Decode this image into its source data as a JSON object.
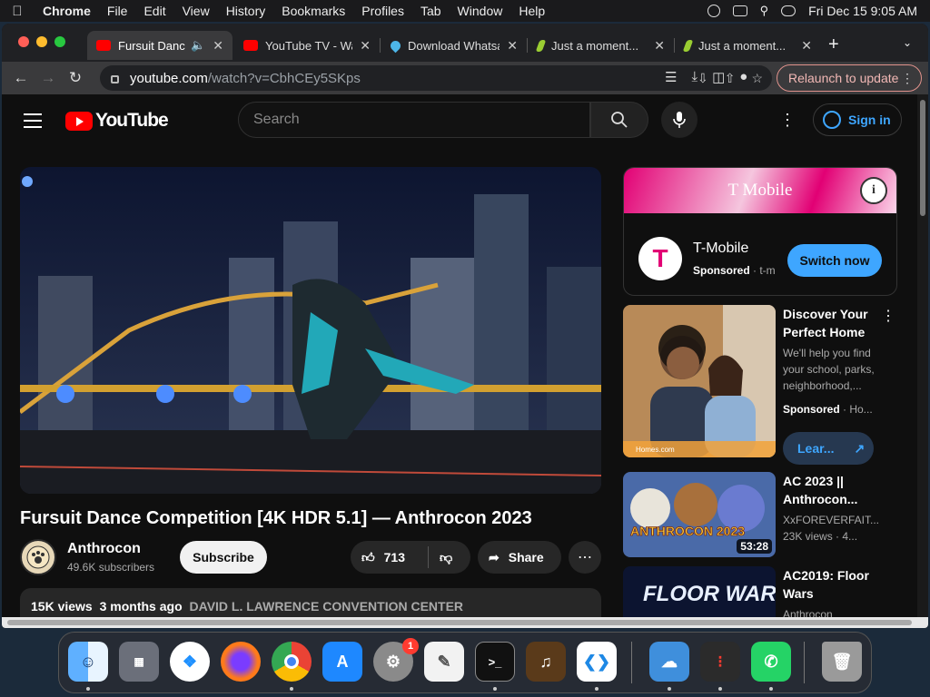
{
  "menubar": {
    "app": "Chrome",
    "items": [
      "File",
      "Edit",
      "View",
      "History",
      "Bookmarks",
      "Profiles",
      "Tab",
      "Window",
      "Help"
    ],
    "clock": "Fri Dec 15  9:05 AM"
  },
  "tabs": [
    {
      "title": "Fursuit Dance",
      "favicon": "youtube-icon",
      "color": "#ff0000",
      "active": true
    },
    {
      "title": "YouTube TV - Wa",
      "favicon": "youtube-icon",
      "color": "#ff0000",
      "active": false
    },
    {
      "title": "Download Whatsa",
      "favicon": "download-icon",
      "color": "#4db6e8",
      "active": false
    },
    {
      "title": "Just a moment...",
      "favicon": "leaf-icon",
      "color": "#9acd32",
      "active": false
    },
    {
      "title": "Just a moment...",
      "favicon": "leaf-icon",
      "color": "#9acd32",
      "active": false
    }
  ],
  "toolbar": {
    "url_host": "youtube.com",
    "url_path": "/watch?v=CbhCEy5SKps",
    "relaunch_label": "Relaunch to update"
  },
  "yt": {
    "logo_text": "YouTube",
    "search_placeholder": "Search",
    "signin_label": "Sign in"
  },
  "video": {
    "title": "Fursuit Dance Competition [4K HDR 5.1] — Anthrocon 2023",
    "channel": "Anthrocon",
    "subscribers": "49.6K subscribers",
    "subscribe_label": "Subscribe",
    "likes": "713",
    "share_label": "Share",
    "views": "15K views",
    "age": "3 months ago",
    "location": "DAVID L. LAWRENCE CONVENTION CENTER"
  },
  "ad": {
    "banner_text": "T Mobile",
    "logo_letter": "T",
    "name": "T-Mobile",
    "sponsored": "Sponsored",
    "domain": "t-m",
    "cta": "Switch now",
    "brand_color": "#e20074"
  },
  "recommendations": [
    {
      "title": "Discover Your Perfect Home",
      "desc": "We'll help you find your school, parks, neighborhood,...",
      "sponsored": "Sponsored",
      "advertiser": "Ho...",
      "cta": "Lear...",
      "brand": "Homes.com"
    },
    {
      "title": "AC 2023 || Anthrocon...",
      "channel": "XxFOREVERFAIT...",
      "meta": "23K views · 4...",
      "duration": "53:28",
      "thumb_text": "ANTHROCON 2023"
    },
    {
      "title": "AC2019: Floor Wars",
      "channel": "Anthrocon",
      "thumb_text": "FLOOR WARS"
    }
  ],
  "dock": [
    {
      "name": "finder-icon",
      "color": "#2f8fe8"
    },
    {
      "name": "launchpad-icon",
      "color": "#6b6f7a"
    },
    {
      "name": "safari-icon",
      "color": "#1e90ff"
    },
    {
      "name": "firefox-icon",
      "color": "#ff7a1a"
    },
    {
      "name": "chrome-icon",
      "color": "#ffffff"
    },
    {
      "name": "app-store-icon",
      "color": "#1e88ff"
    },
    {
      "name": "system-settings-icon",
      "color": "#8a8a8a",
      "badge": "1"
    },
    {
      "name": "textedit-icon",
      "color": "#f2f2f2"
    },
    {
      "name": "terminal-icon",
      "color": "#111111"
    },
    {
      "name": "garageband-icon",
      "color": "#5a3a1a"
    },
    {
      "name": "vscode-icon",
      "color": "#ffffff"
    },
    {
      "name": "weather-icon",
      "color": "#3f8fdc"
    },
    {
      "name": "voice-memos-icon",
      "color": "#2b2b2b"
    },
    {
      "name": "whatsapp-icon",
      "color": "#25d366"
    },
    {
      "name": "trash-icon",
      "color": "#9a9a9a"
    }
  ]
}
